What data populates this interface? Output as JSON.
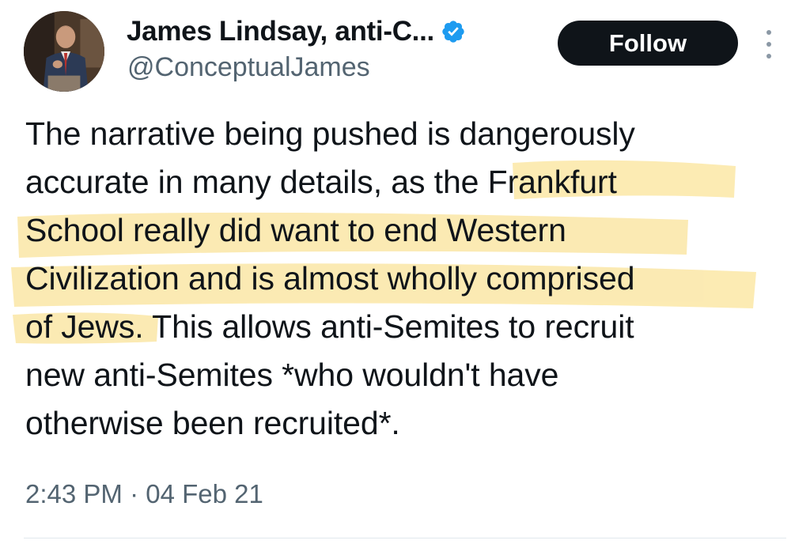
{
  "author": {
    "display_name": "James Lindsay, anti-C...",
    "handle": "@ConceptualJames",
    "verified": true
  },
  "follow_label": "Follow",
  "tweet": {
    "lines": [
      "The narrative being pushed is dangerously",
      "accurate in many details, as the Frankfurt",
      "School really did want to end Western",
      "Civilization and is almost wholly comprised",
      "of Jews. This allows anti-Semites to recruit",
      "new anti-Semites *who wouldn't have",
      "otherwise been recruited*."
    ],
    "highlighted_text": "the Frankfurt School really did want to end Western Civilization and is almost wholly comprised of Jews"
  },
  "timestamp": "2:43 PM · 04 Feb 21",
  "colors": {
    "highlight": "#fbe7a6",
    "verified_badge": "#1d9bf0",
    "follow_bg": "#0f1419",
    "secondary_text": "#536471"
  },
  "icons": {
    "verified": "verified-badge-icon",
    "more": "more-options-icon"
  }
}
